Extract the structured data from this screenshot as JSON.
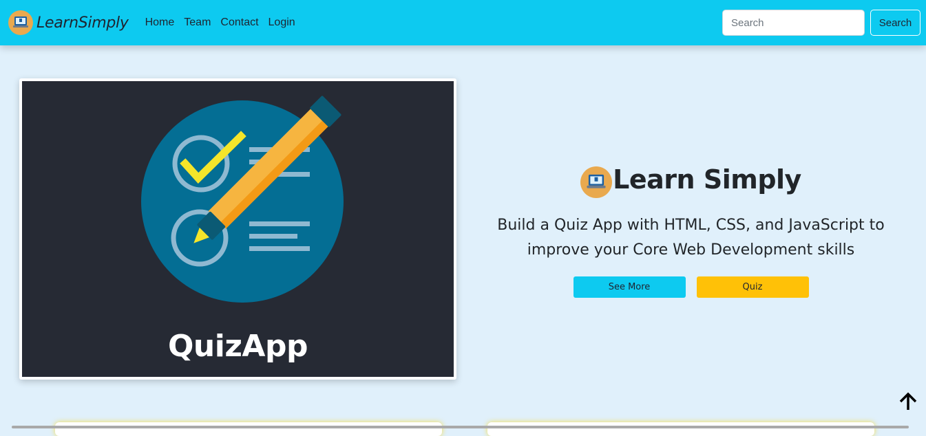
{
  "navbar": {
    "brand": "LearnSimply",
    "links": [
      "Home",
      "Team",
      "Contact",
      "Login"
    ],
    "search_placeholder": "Search",
    "search_button": "Search",
    "background": "#0dcaf0"
  },
  "hero": {
    "image_title": "QuizApp",
    "title": "Learn Simply",
    "description": "Build a Quiz App with HTML, CSS, and JavaScript to improve your Core Web Development skills",
    "buttons": {
      "see_more": "See More",
      "quiz": "Quiz"
    }
  },
  "icons": {
    "brand_logo": "laptop-logo-icon",
    "scroll_top": "arrow-up-icon"
  },
  "colors": {
    "info": "#0dcaf0",
    "warning": "#ffc107",
    "page_bg": "#e0f0fb",
    "image_bg": "#262a34",
    "circle": "#046e94"
  }
}
